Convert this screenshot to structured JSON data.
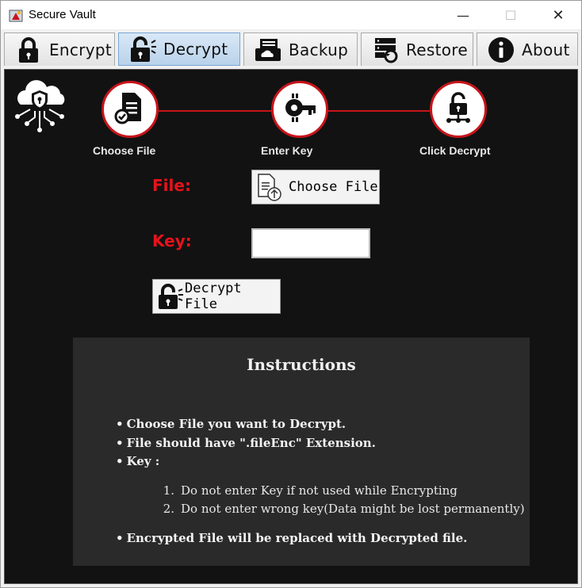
{
  "window": {
    "title": "Secure Vault",
    "minimize_glyph": "—",
    "maximize_glyph": "☐",
    "close_glyph": "✕"
  },
  "tabs": [
    {
      "label": "Encrypt",
      "icon": "lock-icon",
      "active": false
    },
    {
      "label": "Decrypt",
      "icon": "unlock-icon",
      "active": true
    },
    {
      "label": "Backup",
      "icon": "backup-icon",
      "active": false
    },
    {
      "label": "Restore",
      "icon": "restore-icon",
      "active": false
    },
    {
      "label": "About",
      "icon": "info-icon",
      "active": false
    }
  ],
  "steps": [
    {
      "label": "Choose File",
      "icon": "document-check-icon"
    },
    {
      "label": "Enter Key",
      "icon": "key-icon"
    },
    {
      "label": "Click Decrypt",
      "icon": "unlock-network-icon"
    }
  ],
  "form": {
    "file_label": "File:",
    "choose_file_button": "Choose File",
    "key_label": "Key:",
    "key_value": "",
    "decrypt_button": "Decrypt File"
  },
  "instructions": {
    "title": "Instructions",
    "bullets": [
      "Choose File you want to Decrypt.",
      "File should have \".fileEnc\" Extension.",
      "Key :"
    ],
    "key_notes": [
      "Do not enter Key if not used while Encrypting",
      "Do not enter wrong key(Data might be lost permanently)"
    ],
    "final_note": "Encrypted File will be replaced with Decrypted file."
  },
  "colors": {
    "accent_red": "#e8121b",
    "step_border": "#c8141b",
    "panel_bg": "#121212",
    "instructions_bg": "#2a2a2a"
  }
}
